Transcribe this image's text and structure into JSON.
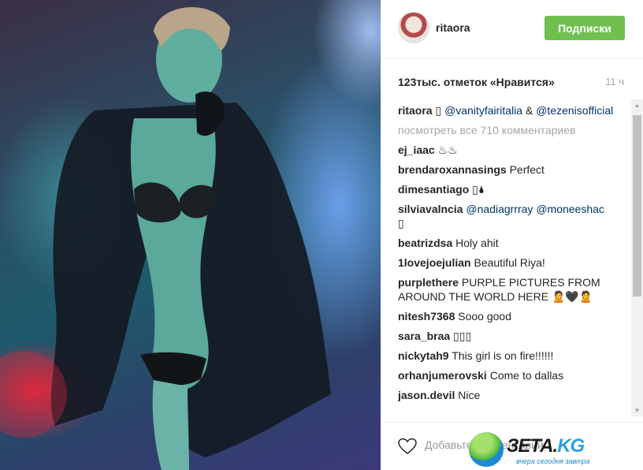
{
  "post": {
    "image_alt": "",
    "username": "ritaora",
    "follow_label": "Подписки",
    "likes": "123тыс. отметок «Нравится»",
    "time": "11 ч"
  },
  "comments": [
    {
      "user": "ritaora",
      "text": " ▯ ",
      "mention1": "@vanityfairitalia",
      "after": " & ",
      "mention2": "@tezenisofficial"
    },
    {
      "viewall": "посмотреть все 710 комментариев"
    },
    {
      "user": "ej_iaac",
      "text": " ♨♨"
    },
    {
      "user": "brendaroxannasings",
      "text": " Perfect"
    },
    {
      "user": "dimesantiago",
      "text": " ▯🌢"
    },
    {
      "user": "silviavalncia",
      "mention1": " @nadiagrrray",
      "mention2": " @moneeshac",
      "text": " ▯"
    },
    {
      "user": "beatrizdsa",
      "text": " Holy ahit"
    },
    {
      "user": "1lovejoejulian",
      "text": " Beautiful Riya!"
    },
    {
      "user": "purplethere",
      "text": " PURPLE PICTURES FROM AROUND THE WORLD HERE 🙎🖤🙎"
    },
    {
      "user": "nitesh7368",
      "text": " Sooo good"
    },
    {
      "user": "sara_braa",
      "text": " ▯▯▯"
    },
    {
      "user": "nickytah9",
      "text": " This girl is on fire!!!!!!"
    },
    {
      "user": "orhanjumerovski",
      "text": " Come to dallas"
    },
    {
      "user": "jason.devil",
      "text": " Nice"
    }
  ],
  "footer": {
    "comment_placeholder": "Добавьте комментарий...",
    "heart_icon": "heart-outline-icon"
  },
  "watermark": {
    "brand": "ЗЕТА.",
    "brand_tld": "KG",
    "tagline": "вчера сегодня завтра"
  },
  "colors": {
    "follow_button": "#70c050",
    "mention": "#003569",
    "muted": "#a5a7aa"
  }
}
